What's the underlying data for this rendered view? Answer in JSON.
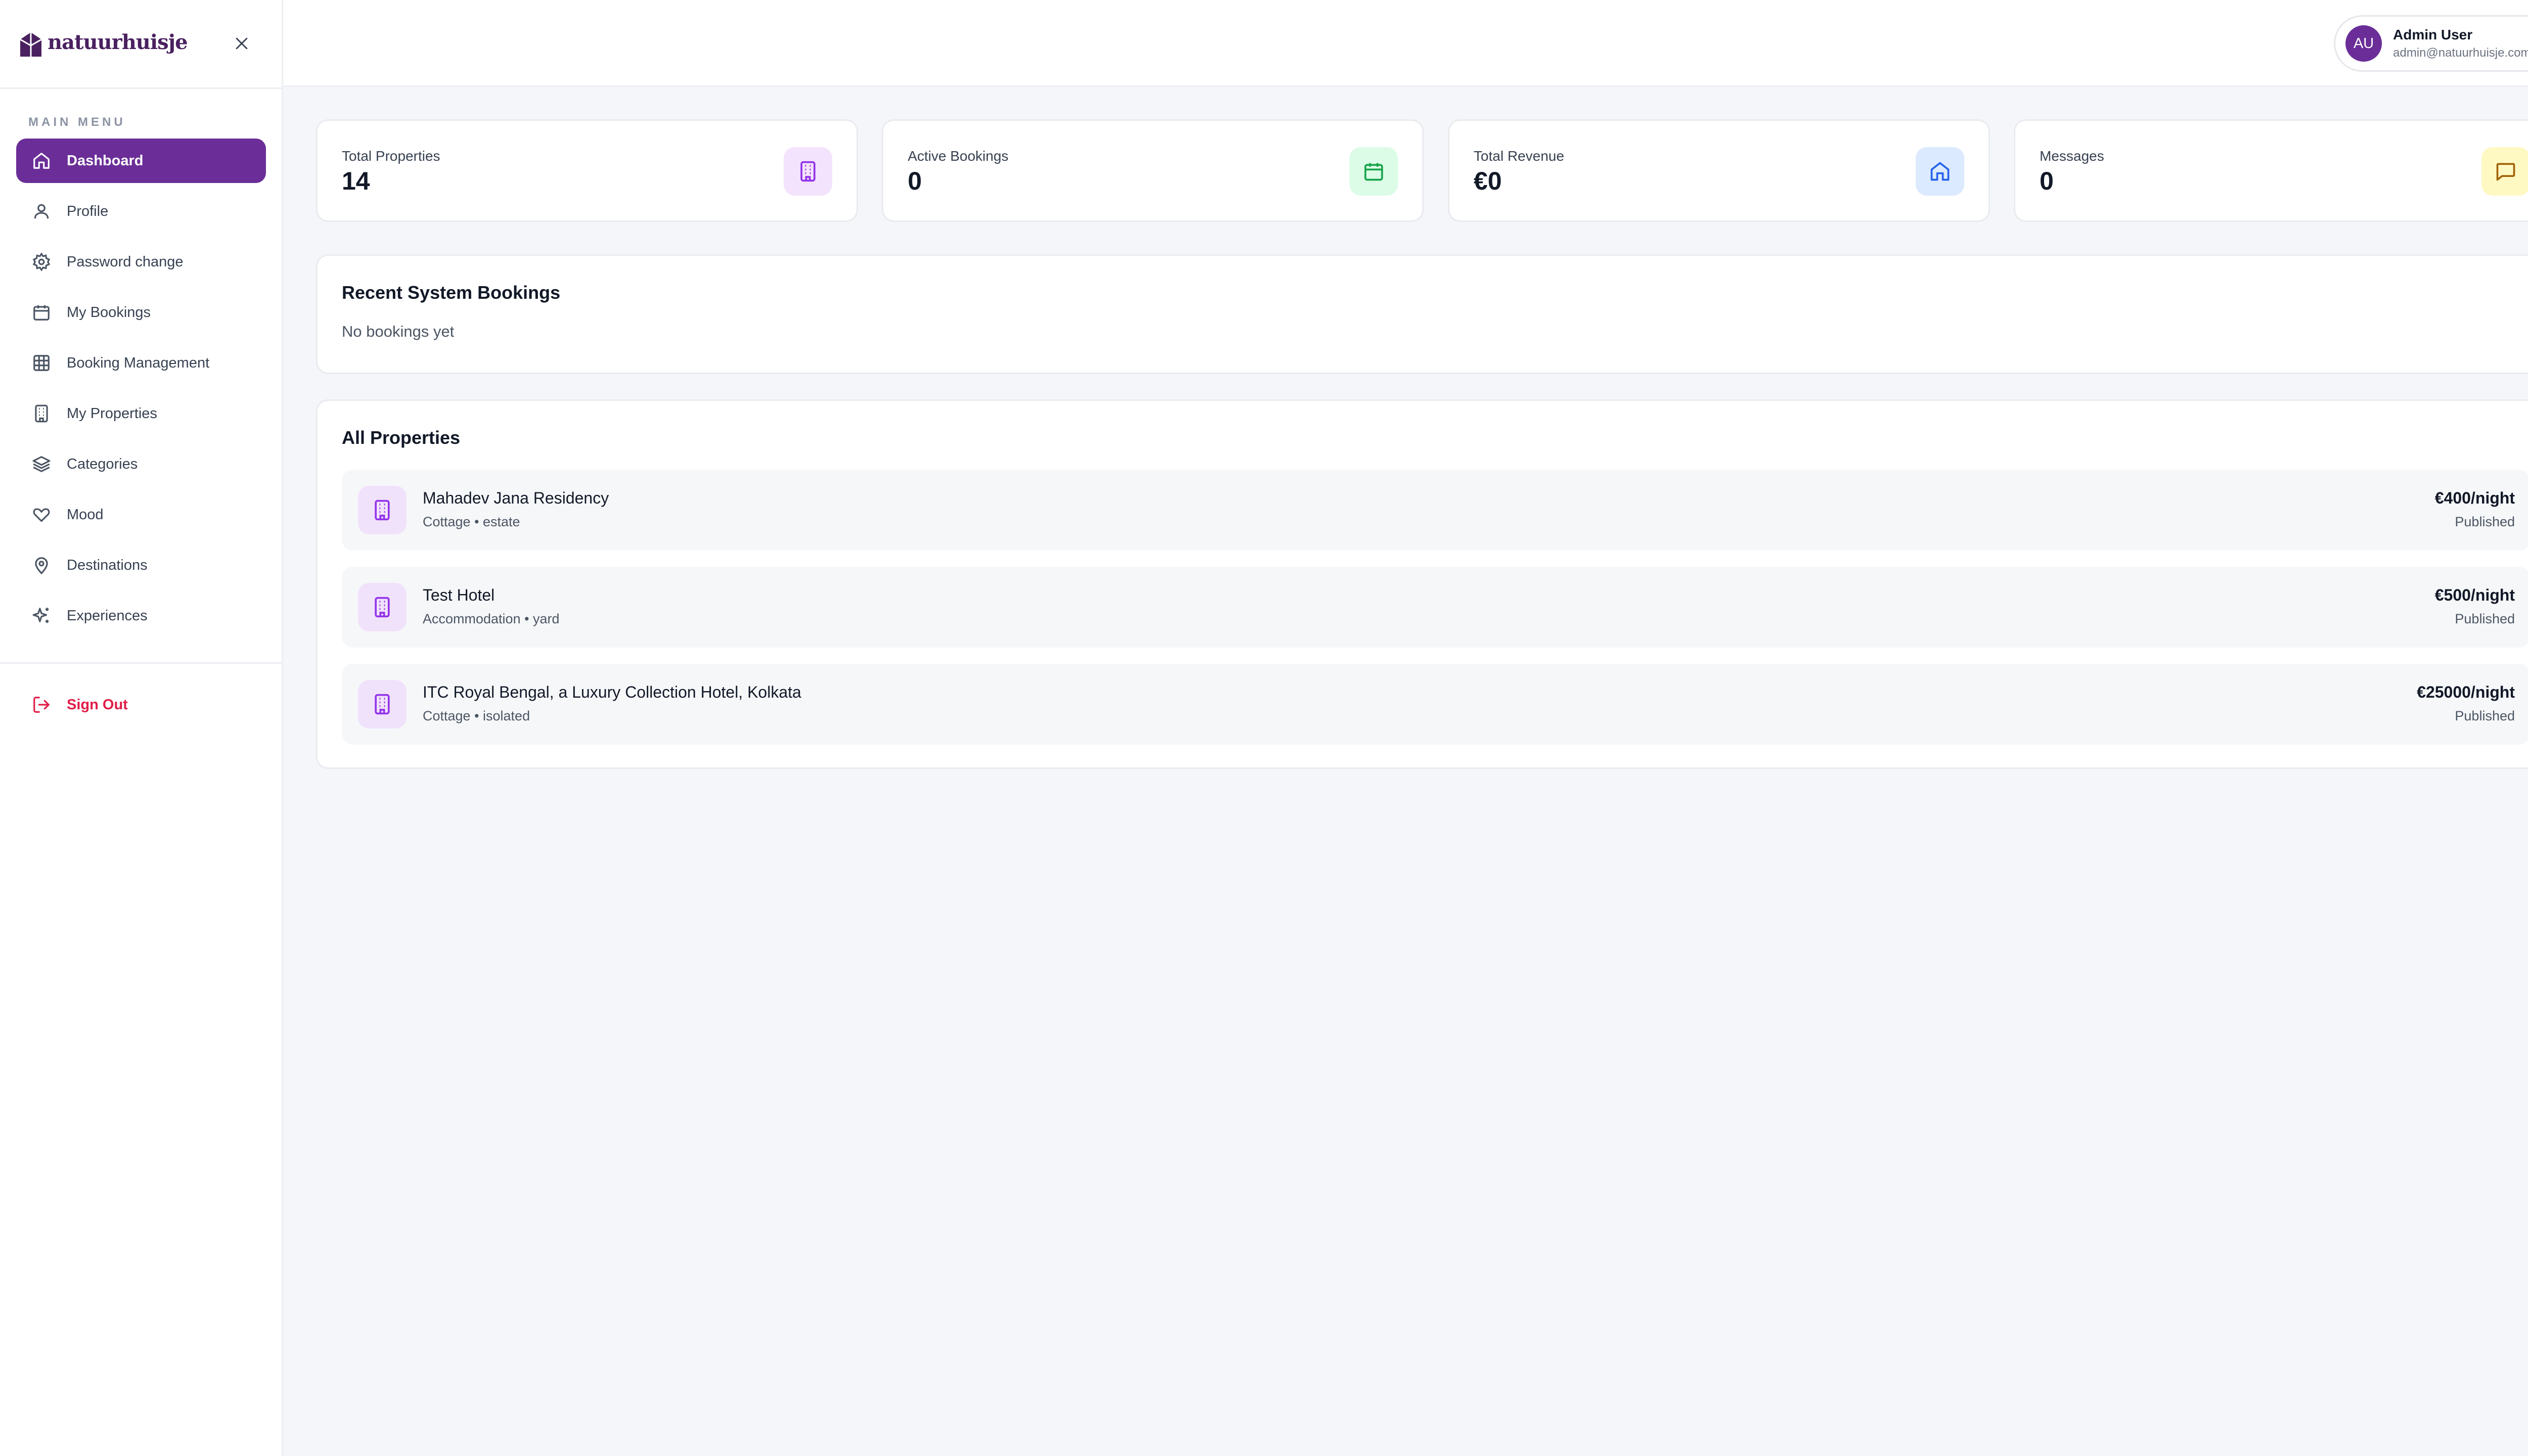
{
  "brand": {
    "name": "natuurhuisje",
    "accent": "#6b2e98"
  },
  "sidebar": {
    "section_label": "MAIN MENU",
    "items": [
      {
        "label": "Dashboard",
        "icon": "home-icon",
        "active": true
      },
      {
        "label": "Profile",
        "icon": "user-icon"
      },
      {
        "label": "Password change",
        "icon": "gear-icon"
      },
      {
        "label": "My Bookings",
        "icon": "calendar-icon"
      },
      {
        "label": "Booking Management",
        "icon": "grid-icon"
      },
      {
        "label": "My Properties",
        "icon": "building-icon"
      },
      {
        "label": "Categories",
        "icon": "layers-icon"
      },
      {
        "label": "Mood",
        "icon": "heart-icon"
      },
      {
        "label": "Destinations",
        "icon": "map-pin-icon"
      },
      {
        "label": "Experiences",
        "icon": "sparkles-icon"
      }
    ],
    "sign_out": "Sign Out"
  },
  "header": {
    "user": {
      "initials": "AU",
      "name": "Admin User",
      "email": "admin@natuurhuisje.com"
    }
  },
  "stats": [
    {
      "label": "Total Properties",
      "value": "14",
      "icon": "building-icon",
      "color": "#9333ea",
      "bg": "#f3e3fc"
    },
    {
      "label": "Active Bookings",
      "value": "0",
      "icon": "calendar-icon",
      "color": "#16a34a",
      "bg": "#dcfce7"
    },
    {
      "label": "Total Revenue",
      "value": "€0",
      "icon": "home-icon",
      "color": "#2563eb",
      "bg": "#dbeafe"
    },
    {
      "label": "Messages",
      "value": "0",
      "icon": "message-icon",
      "color": "#a16207",
      "bg": "#fef9c3"
    }
  ],
  "recent": {
    "title": "Recent System Bookings",
    "empty": "No bookings yet"
  },
  "properties": {
    "title": "All Properties",
    "items": [
      {
        "name": "Mahadev Jana Residency",
        "meta": "Cottage • estate",
        "price": "€400/night",
        "status": "Published"
      },
      {
        "name": "Test Hotel",
        "meta": "Accommodation • yard",
        "price": "€500/night",
        "status": "Published"
      },
      {
        "name": "ITC Royal Bengal, a Luxury Collection Hotel, Kolkata",
        "meta": "Cottage • isolated",
        "price": "€25000/night",
        "status": "Published"
      }
    ]
  }
}
